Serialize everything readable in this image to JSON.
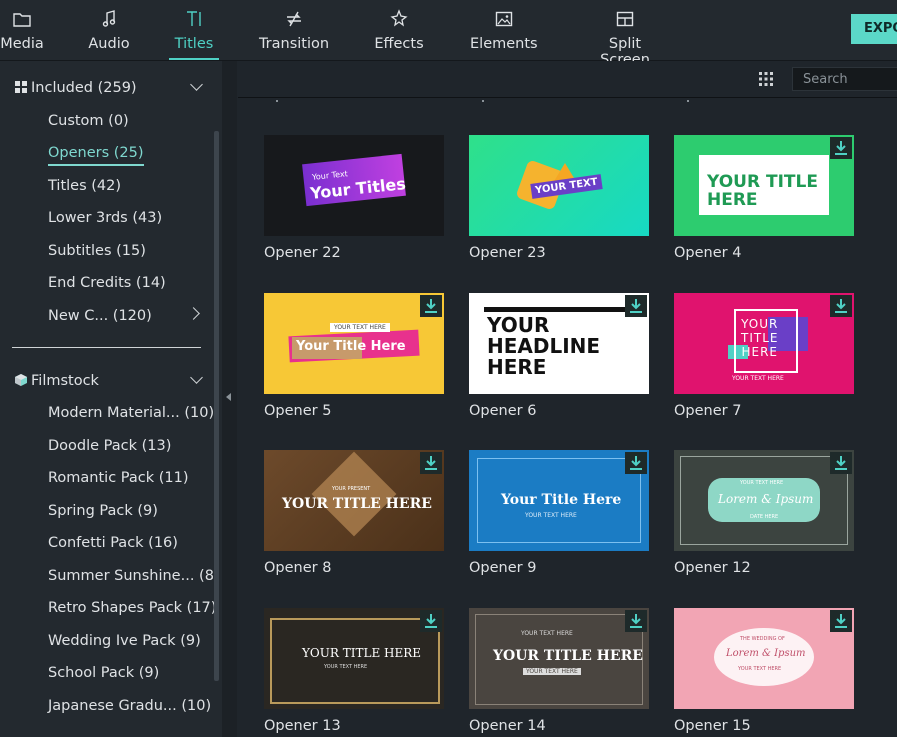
{
  "tabs": [
    {
      "label": "Media",
      "icon": "folder-icon"
    },
    {
      "label": "Audio",
      "icon": "music-note-icon"
    },
    {
      "label": "Titles",
      "icon": "text-icon",
      "active": true
    },
    {
      "label": "Transition",
      "icon": "transition-icon"
    },
    {
      "label": "Effects",
      "icon": "effects-icon"
    },
    {
      "label": "Elements",
      "icon": "image-icon"
    },
    {
      "label": "Split Screen",
      "icon": "split-screen-icon"
    }
  ],
  "export_label": "EXPO",
  "sidebar": {
    "included": {
      "header": "Included (259)",
      "items": [
        {
          "label": "Custom (0)"
        },
        {
          "label": "Openers (25)",
          "active": true
        },
        {
          "label": "Titles (42)"
        },
        {
          "label": "Lower 3rds (43)"
        },
        {
          "label": "Subtitles (15)"
        },
        {
          "label": "End Credits (14)"
        },
        {
          "label": "New C... (120)"
        }
      ]
    },
    "filmstock": {
      "header": "Filmstock",
      "items": [
        {
          "label": "Modern Material... (10)"
        },
        {
          "label": "Doodle Pack (13)"
        },
        {
          "label": "Romantic Pack (11)"
        },
        {
          "label": "Spring Pack (9)"
        },
        {
          "label": "Confetti Pack (16)"
        },
        {
          "label": "Summer Sunshine... (8)"
        },
        {
          "label": "Retro Shapes Pack (17)"
        },
        {
          "label": "Wedding Ive Pack (9)"
        },
        {
          "label": "School Pack (9)"
        },
        {
          "label": "Japanese Gradu... (10)"
        }
      ]
    }
  },
  "search": {
    "placeholder": "Search"
  },
  "cards": [
    {
      "label": "Opener 22",
      "text1": "Your Text",
      "text2": "Your Titles",
      "download": false
    },
    {
      "label": "Opener 23",
      "text1": "YOUR TEXT",
      "download": false
    },
    {
      "label": "Opener 4",
      "text1": "YOUR TITLE",
      "text2": "HERE",
      "download": true
    },
    {
      "label": "Opener 5",
      "text1": "YOUR TEXT HERE",
      "text2": "Your Title Here",
      "download": true
    },
    {
      "label": "Opener 6",
      "text1": "YOUR",
      "text2": "HEADLINE",
      "text3": "HERE",
      "download": true
    },
    {
      "label": "Opener 7",
      "text1": "YOUR",
      "text2": "TITLE",
      "text3": "HERE",
      "text4": "YOUR TEXT HERE",
      "download": true
    },
    {
      "label": "Opener 8",
      "text1": "YOUR PRESENT",
      "text2": "YOUR TITLE HERE",
      "download": true
    },
    {
      "label": "Opener 9",
      "text1": "Your Title Here",
      "text2": "YOUR TEXT HERE",
      "download": true
    },
    {
      "label": "Opener 12",
      "text1": "YOUR TEXT HERE",
      "text2": "Lorem & Ipsum",
      "text3": "DATE HERE",
      "download": true
    },
    {
      "label": "Opener 13",
      "text1": "YOUR TITLE HERE",
      "text2": "YOUR TEXT HERE",
      "download": true
    },
    {
      "label": "Opener 14",
      "text1": "YOUR TEXT HERE",
      "text2": "YOUR TITLE HERE",
      "text3": "YOUR TEXT HERE",
      "download": true
    },
    {
      "label": "Opener 15",
      "text1": "THE WEDDING OF",
      "text2": "Lorem & Ipsum",
      "text3": "YOUR TEXT HERE",
      "download": true
    }
  ],
  "colors": {
    "accent": "#4fd1c5",
    "background": "#1f252b",
    "sidebar": "#23292f"
  }
}
